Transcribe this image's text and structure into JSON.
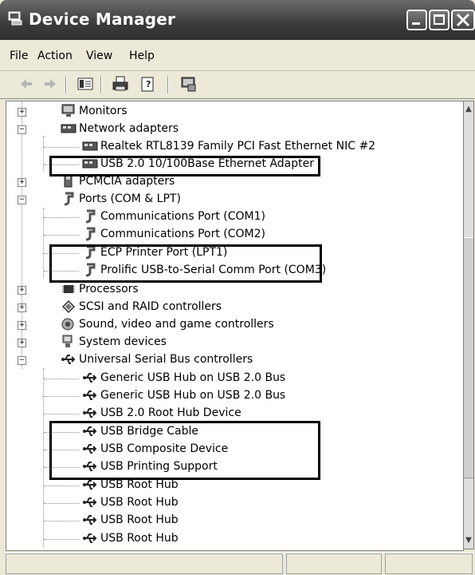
{
  "window": {
    "title": "Device Manager",
    "icon": "device-manager-icon"
  },
  "menu": [
    "File",
    "Action",
    "View",
    "Help"
  ],
  "toolbar": [
    "back-icon",
    "forward-icon",
    "show-hide-tree-icon",
    "print-icon",
    "properties-icon",
    "scan-hardware-icon"
  ],
  "tree": {
    "monitors": "Monitors",
    "network": "Network adapters",
    "net_realtek": "Realtek RTL8139 Family PCI Fast Ethernet NIC #2",
    "net_usb": "USB 2.0 10/100Base Ethernet Adapter",
    "pcmcia": "PCMCIA adapters",
    "ports": "Ports (COM & LPT)",
    "port_com1": "Communications Port (COM1)",
    "port_com2": "Communications Port (COM2)",
    "port_lpt1": "ECP Printer Port (LPT1)",
    "port_com3": "Prolific USB-to-Serial Comm Port (COM3)",
    "processors": "Processors",
    "scsi": "SCSI and RAID controllers",
    "sound": "Sound, video and game controllers",
    "system": "System devices",
    "usb": "Universal Serial Bus controllers",
    "usb_hub1": "Generic USB Hub on USB 2.0 Bus",
    "usb_hub2": "Generic USB Hub on USB 2.0 Bus",
    "usb_root20": "USB 2.0 Root Hub Device",
    "usb_bridge": "USB Bridge Cable",
    "usb_composite": "USB Composite Device",
    "usb_printing": "USB Printing Support",
    "usb_root1": "USB Root Hub",
    "usb_root2": "USB Root Hub",
    "usb_root3": "USB Root Hub",
    "usb_root4": "USB Root Hub"
  }
}
